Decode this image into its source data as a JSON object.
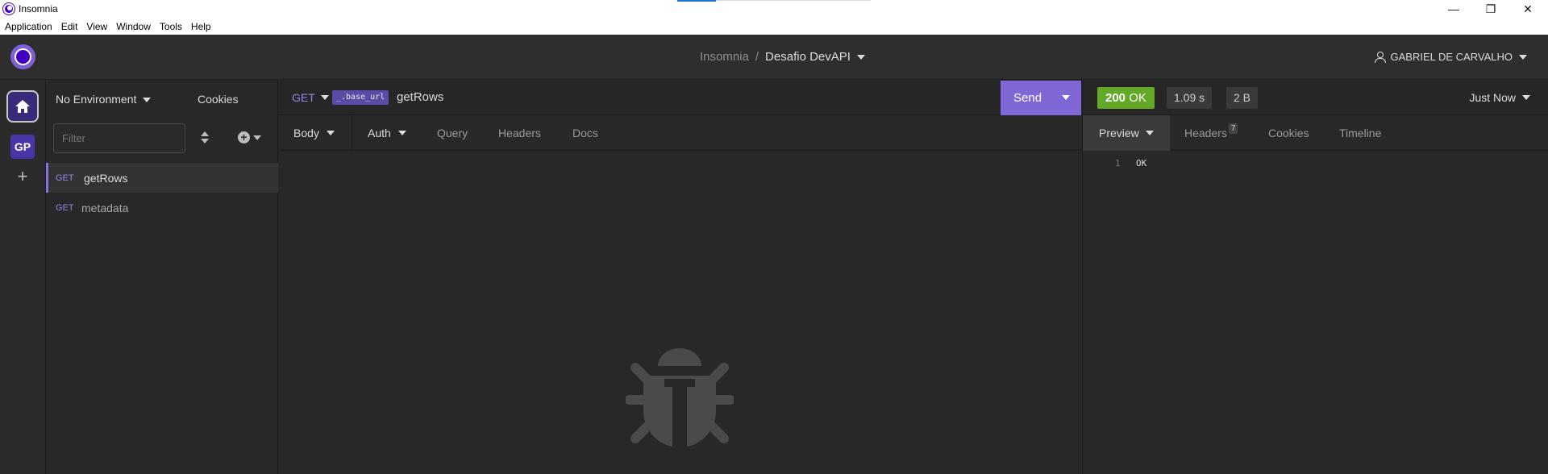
{
  "window": {
    "title": "Insomnia",
    "controls": {
      "minimize": "—",
      "maximize": "❐",
      "close": "✕"
    }
  },
  "menu": [
    "Application",
    "Edit",
    "View",
    "Window",
    "Tools",
    "Help"
  ],
  "header": {
    "app_name": "Insomnia",
    "separator": "/",
    "project": "Desafio DevAPI",
    "user": "GABRIEL DE CARVALHO"
  },
  "rail": {
    "workspace_initials": "GP",
    "add_symbol": "+"
  },
  "sidebar": {
    "environment": "No Environment",
    "cookies": "Cookies",
    "filter_placeholder": "Filter",
    "add_symbol": "+",
    "requests": [
      {
        "method": "GET",
        "name": "getRows",
        "active": true
      },
      {
        "method": "GET",
        "name": "metadata",
        "active": false
      }
    ]
  },
  "request": {
    "method": "GET",
    "base_url_tag": "_.base_url",
    "path": "getRows",
    "send_label": "Send",
    "tabs": {
      "body": "Body",
      "auth": "Auth",
      "query": "Query",
      "headers": "Headers",
      "docs": "Docs"
    }
  },
  "response": {
    "status_code": "200",
    "status_text": "OK",
    "time": "1.09 s",
    "size": "2 B",
    "history": "Just Now",
    "tabs": {
      "preview": "Preview",
      "headers": "Headers",
      "headers_count": "7",
      "cookies": "Cookies",
      "timeline": "Timeline"
    },
    "body": [
      {
        "line": "1",
        "text": "OK"
      }
    ]
  },
  "colors": {
    "accent": "#8166d6",
    "status_ok": "#64a827",
    "method_get": "#9b82e6",
    "background": "#282828"
  }
}
